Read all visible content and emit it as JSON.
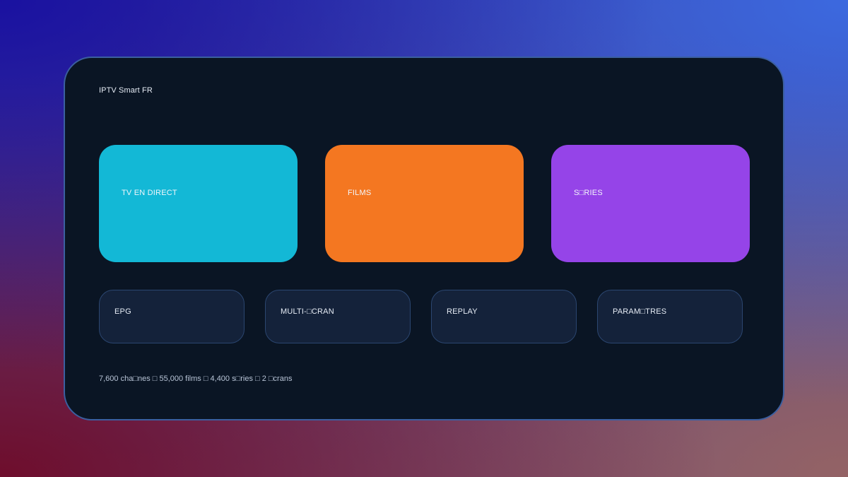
{
  "app": {
    "title": "IPTV Smart FR"
  },
  "main_tiles": [
    {
      "label": "TV EN DIRECT",
      "color": "#13b8d6"
    },
    {
      "label": "FILMS",
      "color": "#f47721"
    },
    {
      "label": "S□RIES",
      "color": "#9544e8"
    }
  ],
  "secondary_tiles": [
    {
      "label": "EPG"
    },
    {
      "label": "MULTI-□CRAN"
    },
    {
      "label": "REPLAY"
    },
    {
      "label": "PARAM□TRES"
    }
  ],
  "footer": {
    "stats": "7,600 cha□nes □ 55,000 films □ 4,400 s□ries □ 2 □crans"
  },
  "colors": {
    "panel_background": "#0a1524",
    "panel_border": "#3b5fa0",
    "secondary_tile_background": "#14223a",
    "secondary_tile_border": "#2b4670"
  }
}
